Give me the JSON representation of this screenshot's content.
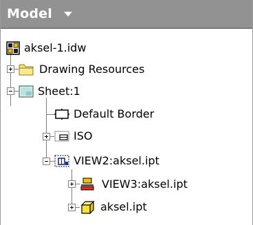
{
  "header": {
    "title": "Model"
  },
  "tree": {
    "root": {
      "label": "aksel-1.idw",
      "icon": "idw-drawing-icon"
    },
    "items": [
      {
        "label": "Drawing Resources",
        "icon": "folder-icon",
        "expander": "plus"
      },
      {
        "label": "Sheet:1",
        "icon": "sheet-icon",
        "expander": "minus"
      },
      {
        "label": "Default Border",
        "icon": "border-icon"
      },
      {
        "label": "ISO",
        "icon": "title-block-icon",
        "expander": "plus"
      },
      {
        "label": "VIEW2:aksel.ipt",
        "icon": "drawing-view-icon",
        "expander": "minus"
      },
      {
        "label": "VIEW3:aksel.ipt",
        "icon": "section-view-icon",
        "expander": "plus"
      },
      {
        "label": "aksel.ipt",
        "icon": "part-icon",
        "expander": "plus"
      }
    ]
  }
}
